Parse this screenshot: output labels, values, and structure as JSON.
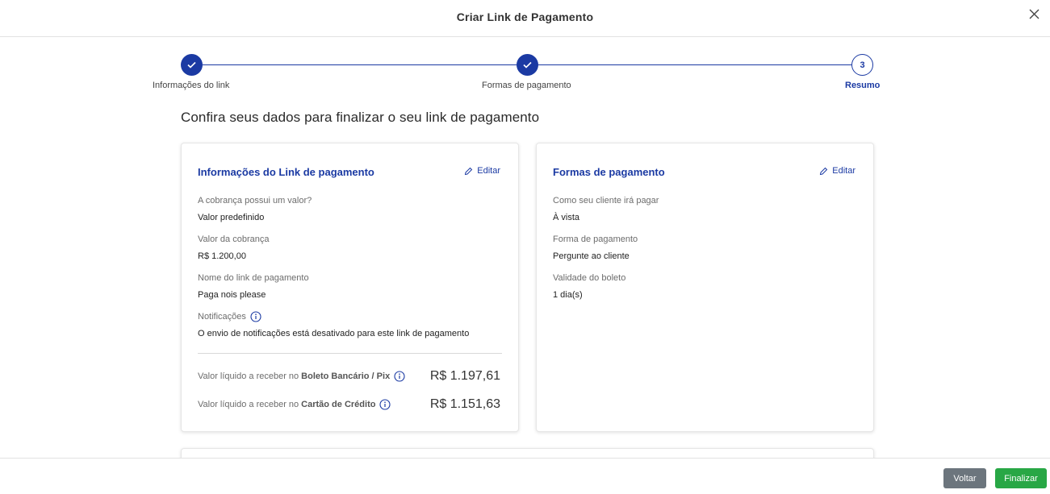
{
  "header": {
    "title": "Criar Link de Pagamento",
    "close_icon": "close-icon"
  },
  "stepper": {
    "steps": [
      {
        "label": "Informações do link",
        "state": "done"
      },
      {
        "label": "Formas de pagamento",
        "state": "done"
      },
      {
        "label": "Resumo",
        "number": "3",
        "state": "current"
      }
    ]
  },
  "main": {
    "heading": "Confira seus dados para finalizar o seu link de pagamento"
  },
  "link_info": {
    "title": "Informações do Link de pagamento",
    "edit_label": "Editar",
    "fields": [
      {
        "label": "A cobrança possui um valor?",
        "value": "Valor predefinido"
      },
      {
        "label": "Valor da cobrança",
        "value": "R$ 1.200,00"
      },
      {
        "label": "Nome do link de pagamento",
        "value": "Paga nois please"
      },
      {
        "label": "Notificações",
        "value": "O envio de notificações está desativado para este link de pagamento"
      }
    ],
    "net": [
      {
        "prefix": "Valor líquido a receber no",
        "method": "Boleto Bancário / Pix",
        "value": "R$ 1.197,61"
      },
      {
        "prefix": "Valor líquido a receber no",
        "method": "Cartão de Crédito",
        "value": "R$ 1.151,63"
      }
    ]
  },
  "payment_methods": {
    "title": "Formas de pagamento",
    "edit_label": "Editar",
    "fields": [
      {
        "label": "Como seu cliente irá pagar",
        "value": "À vista"
      },
      {
        "label": "Forma de pagamento",
        "value": "Pergunte ao cliente"
      },
      {
        "label": "Validade do boleto",
        "value": "1 dia(s)"
      }
    ]
  },
  "footer": {
    "back_label": "Voltar",
    "finish_label": "Finalizar"
  },
  "colors": {
    "primary": "#1b3aa3",
    "success": "#28a745",
    "secondary": "#6c757d"
  }
}
